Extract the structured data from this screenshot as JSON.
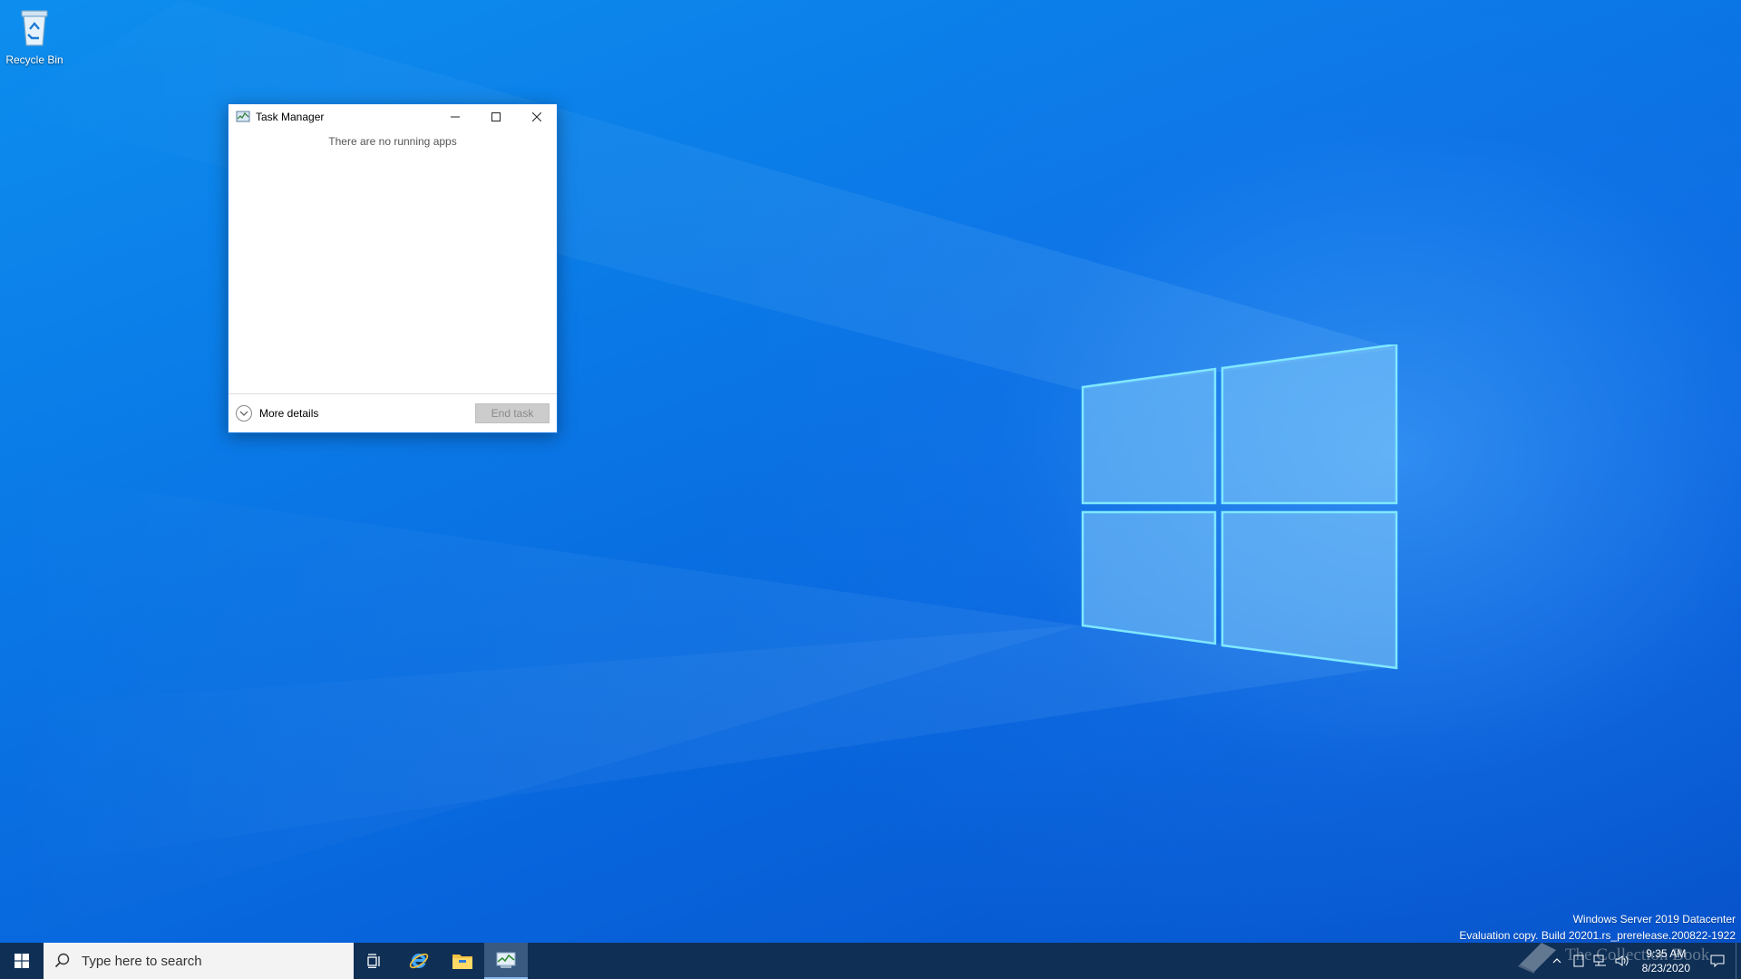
{
  "desktop": {
    "icons": [
      {
        "label": "Recycle Bin",
        "icon": "recycle-bin-icon"
      }
    ]
  },
  "task_manager": {
    "title": "Task Manager",
    "empty_message": "There are no running apps",
    "more_details_label": "More details",
    "end_task_label": "End task",
    "controls": [
      "minimize",
      "maximize",
      "close"
    ]
  },
  "watermark": {
    "line1": "Windows Server 2019 Datacenter",
    "line2": "Evaluation copy. Build 20201.rs_prerelease.200822-1922"
  },
  "taskbar": {
    "search_placeholder": "Type here to search",
    "pinned": [
      {
        "name": "task-view",
        "icon": "task-view-icon"
      },
      {
        "name": "internet-explorer",
        "icon": "internet-explorer-icon"
      },
      {
        "name": "file-explorer",
        "icon": "folder-icon"
      },
      {
        "name": "task-manager",
        "icon": "task-manager-icon",
        "active": true
      }
    ],
    "clock": {
      "time": "9:35 AM",
      "date": "8/23/2020"
    },
    "brand_overlay": "The Collection Book"
  },
  "colors": {
    "taskbar_bg": "#0f2f55",
    "window_border": "#1a7ae0",
    "accent": "#0078d7"
  }
}
